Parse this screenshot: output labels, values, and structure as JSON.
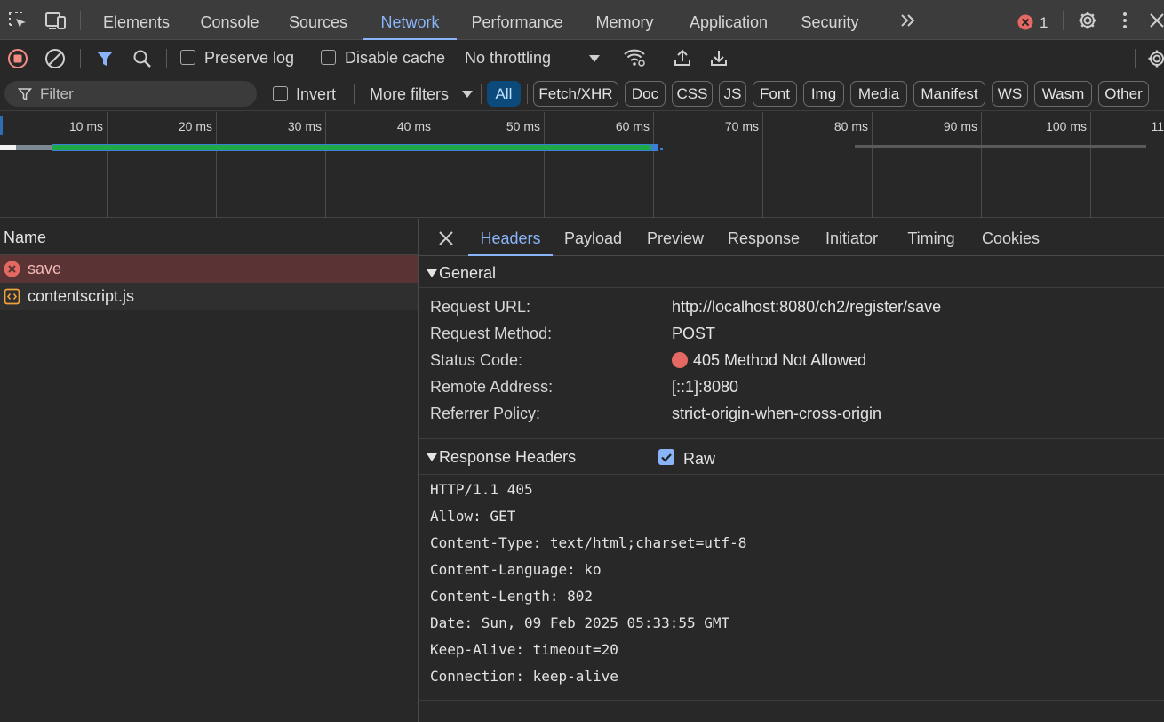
{
  "top_tabs": [
    "Elements",
    "Console",
    "Sources",
    "Network",
    "Performance",
    "Memory",
    "Application",
    "Security"
  ],
  "active_tab": "Network",
  "error_count": "1",
  "toolbar": {
    "preserve_log": "Preserve log",
    "disable_cache": "Disable cache",
    "throttling": "No throttling"
  },
  "filter": {
    "placeholder": "Filter",
    "invert": "Invert",
    "more_filters": "More filters",
    "chips": [
      "All",
      "Fetch/XHR",
      "Doc",
      "CSS",
      "JS",
      "Font",
      "Img",
      "Media",
      "Manifest",
      "WS",
      "Wasm",
      "Other"
    ],
    "selected_chip": "All"
  },
  "timeline": {
    "ticks": [
      "10 ms",
      "20 ms",
      "30 ms",
      "40 ms",
      "50 ms",
      "60 ms",
      "70 ms",
      "80 ms",
      "90 ms",
      "100 ms",
      "11"
    ]
  },
  "requests": {
    "header": "Name",
    "items": [
      {
        "name": "save",
        "status": "error"
      },
      {
        "name": "contentscript.js",
        "status": "ok"
      }
    ]
  },
  "details": {
    "tabs": [
      "Headers",
      "Payload",
      "Preview",
      "Response",
      "Initiator",
      "Timing",
      "Cookies"
    ],
    "active_tab": "Headers",
    "general": {
      "title": "General",
      "rows": [
        {
          "key": "Request URL:",
          "value": "http://localhost:8080/ch2/register/save"
        },
        {
          "key": "Request Method:",
          "value": "POST"
        },
        {
          "key": "Status Code:",
          "value": "405 Method Not Allowed"
        },
        {
          "key": "Remote Address:",
          "value": "[::1]:8080"
        },
        {
          "key": "Referrer Policy:",
          "value": "strict-origin-when-cross-origin"
        }
      ]
    },
    "response_headers": {
      "title": "Response Headers",
      "raw_label": "Raw",
      "lines": [
        "HTTP/1.1 405",
        "Allow: GET",
        "Content-Type: text/html;charset=utf-8",
        "Content-Language: ko",
        "Content-Length: 802",
        "Date: Sun, 09 Feb 2025 05:33:55 GMT",
        "Keep-Alive: timeout=20",
        "Connection: keep-alive"
      ]
    }
  },
  "colors": {
    "accent": "#8ab4f8",
    "error": "#f28b82",
    "error_row": "#5a3434",
    "waterfall": "#1eaa48"
  }
}
